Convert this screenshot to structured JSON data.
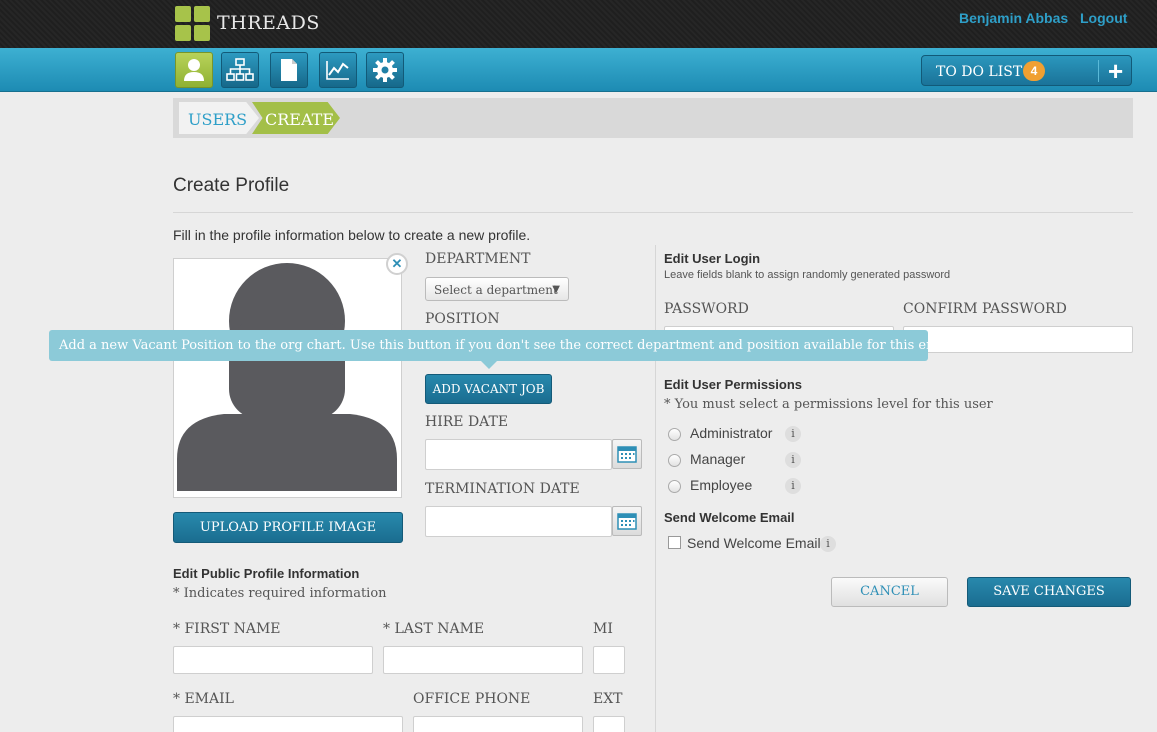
{
  "header": {
    "brand": "THREADS",
    "user_name": "Benjamin Abbas",
    "logout": "Logout"
  },
  "nav": {
    "icons": [
      "user-icon",
      "org-chart-icon",
      "document-icon",
      "chart-icon",
      "gear-icon"
    ],
    "todo_label": "TO DO LIST",
    "todo_count": "4",
    "todo_add": "+"
  },
  "breadcrumb": {
    "users": "USERS",
    "create": "CREATE"
  },
  "page": {
    "title": "Create Profile",
    "intro": "Fill in the profile information below to create a new profile."
  },
  "left": {
    "upload_button": "UPLOAD PROFILE IMAGE",
    "department_label": "DEPARTMENT",
    "department_placeholder": "Select a department",
    "position_label": "POSITION",
    "add_vacant_job": "ADD VACANT JOB",
    "hire_date_label": "HIRE DATE",
    "hire_date_value": "",
    "termination_date_label": "TERMINATION DATE",
    "termination_date_value": "",
    "public_heading": "Edit Public Profile Information",
    "required_note": "* Indicates required information",
    "first_name_label": "* FIRST NAME",
    "last_name_label": "* LAST NAME",
    "mi_label": "MI",
    "email_label": "* EMAIL",
    "office_phone_label": "OFFICE PHONE",
    "ext_label": "EXT"
  },
  "tooltip": {
    "text": "Add a new Vacant Position to the org chart. Use this button if you don't see the correct department and position available for this employee."
  },
  "right": {
    "login_heading": "Edit User Login",
    "login_note": "Leave fields blank to assign randomly generated password",
    "password_label": "PASSWORD",
    "confirm_password_label": "CONFIRM PASSWORD",
    "permissions_heading": "Edit User Permissions",
    "permissions_note": "* You must select a permissions level for this user",
    "roles": [
      "Administrator",
      "Manager",
      "Employee"
    ],
    "info_glyph": "i",
    "welcome_heading": "Send Welcome Email",
    "welcome_checkbox": "Send Welcome Email",
    "cancel": "CANCEL",
    "save": "SAVE CHANGES"
  },
  "colors": {
    "accent_blue": "#2e9fc8",
    "nav_blue": "#1d8bb3",
    "accent_green": "#a3bf48",
    "badge_orange": "#f0a032",
    "tooltip_blue": "#8ccad8"
  }
}
